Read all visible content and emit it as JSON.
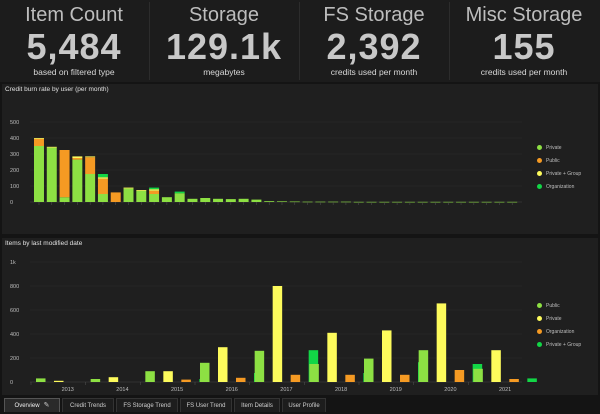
{
  "kpis": [
    {
      "title": "Item Count",
      "value": "5,484",
      "subtitle": "based on filtered type"
    },
    {
      "title": "Storage",
      "value": "129.1k",
      "subtitle": "megabytes"
    },
    {
      "title": "FS Storage",
      "value": "2,392",
      "subtitle": "credits used per month"
    },
    {
      "title": "Misc Storage",
      "value": "155",
      "subtitle": "credits used per month"
    }
  ],
  "tabs": [
    {
      "label": "Overview"
    },
    {
      "label": "Credit Trends"
    },
    {
      "label": "FS Storage Trend"
    },
    {
      "label": "FS User Trend"
    },
    {
      "label": "Item Details"
    },
    {
      "label": "User Profile"
    }
  ],
  "colors": {
    "private": "#8de043",
    "public": "#f59a23",
    "private_group": "#fdfb5c",
    "organization": "#12d646"
  },
  "chart_data": [
    {
      "type": "bar",
      "stacked": true,
      "title": "Credit burn rate by user (per month)",
      "ylim": [
        0,
        500
      ],
      "yticks": [
        "0",
        "100",
        "200",
        "300",
        "400",
        "500"
      ],
      "grid": true,
      "legend_position": "right",
      "series": [
        {
          "name": "Private",
          "color": "#8de043",
          "values": [
            350,
            340,
            30,
            265,
            175,
            50,
            0,
            85,
            70,
            50,
            30,
            55,
            20,
            25,
            20,
            18,
            20,
            15,
            5,
            4,
            3,
            2,
            2,
            2,
            2,
            1,
            1,
            1,
            1,
            1,
            1,
            1,
            1,
            1,
            1,
            1,
            1,
            1
          ]
        },
        {
          "name": "Public",
          "color": "#f59a23",
          "values": [
            45,
            0,
            295,
            10,
            105,
            95,
            60,
            0,
            0,
            20,
            0,
            0,
            0,
            0,
            0,
            0,
            0,
            0,
            0,
            0,
            0,
            0,
            0,
            0,
            0,
            0,
            0,
            0,
            0,
            0,
            0,
            0,
            0,
            0,
            0,
            0,
            0,
            0
          ]
        },
        {
          "name": "Private + Group",
          "color": "#fdfb5c",
          "values": [
            5,
            5,
            0,
            10,
            5,
            10,
            0,
            5,
            5,
            10,
            0,
            0,
            0,
            0,
            0,
            0,
            0,
            0,
            0,
            0,
            0,
            0,
            0,
            0,
            0,
            0,
            0,
            0,
            0,
            0,
            0,
            0,
            0,
            0,
            0,
            0,
            0,
            0
          ]
        },
        {
          "name": "Organization",
          "color": "#12d646",
          "values": [
            0,
            0,
            0,
            0,
            0,
            20,
            0,
            0,
            0,
            10,
            0,
            10,
            0,
            0,
            0,
            0,
            0,
            0,
            0,
            0,
            0,
            0,
            0,
            0,
            0,
            0,
            0,
            0,
            0,
            0,
            0,
            0,
            0,
            0,
            0,
            0,
            0,
            0
          ]
        }
      ]
    },
    {
      "type": "bar",
      "title": "Items by last modified date",
      "categories": [
        "2013",
        "2014",
        "2015",
        "2016",
        "2017",
        "2018",
        "2019",
        "2020",
        "2021"
      ],
      "ylim": [
        0,
        1000
      ],
      "yticks": [
        "0",
        "200",
        "400",
        "600",
        "800",
        "1k"
      ],
      "grid": true,
      "legend_position": "right",
      "series": [
        {
          "name": "Public",
          "color": "#8de043",
          "values": [
            30,
            25,
            90,
            160,
            260,
            150,
            195,
            265,
            110
          ]
        },
        {
          "name": "Private",
          "color": "#fdfb5c",
          "values": [
            10,
            40,
            90,
            290,
            800,
            410,
            430,
            655,
            265
          ]
        },
        {
          "name": "Organization",
          "color": "#f59a23",
          "values": [
            0,
            0,
            20,
            35,
            60,
            60,
            60,
            100,
            25
          ]
        },
        {
          "name": "Private + Group",
          "color": "#12d646",
          "values": [
            0,
            0,
            25,
            75,
            265,
            75,
            165,
            150,
            30
          ]
        }
      ]
    }
  ]
}
